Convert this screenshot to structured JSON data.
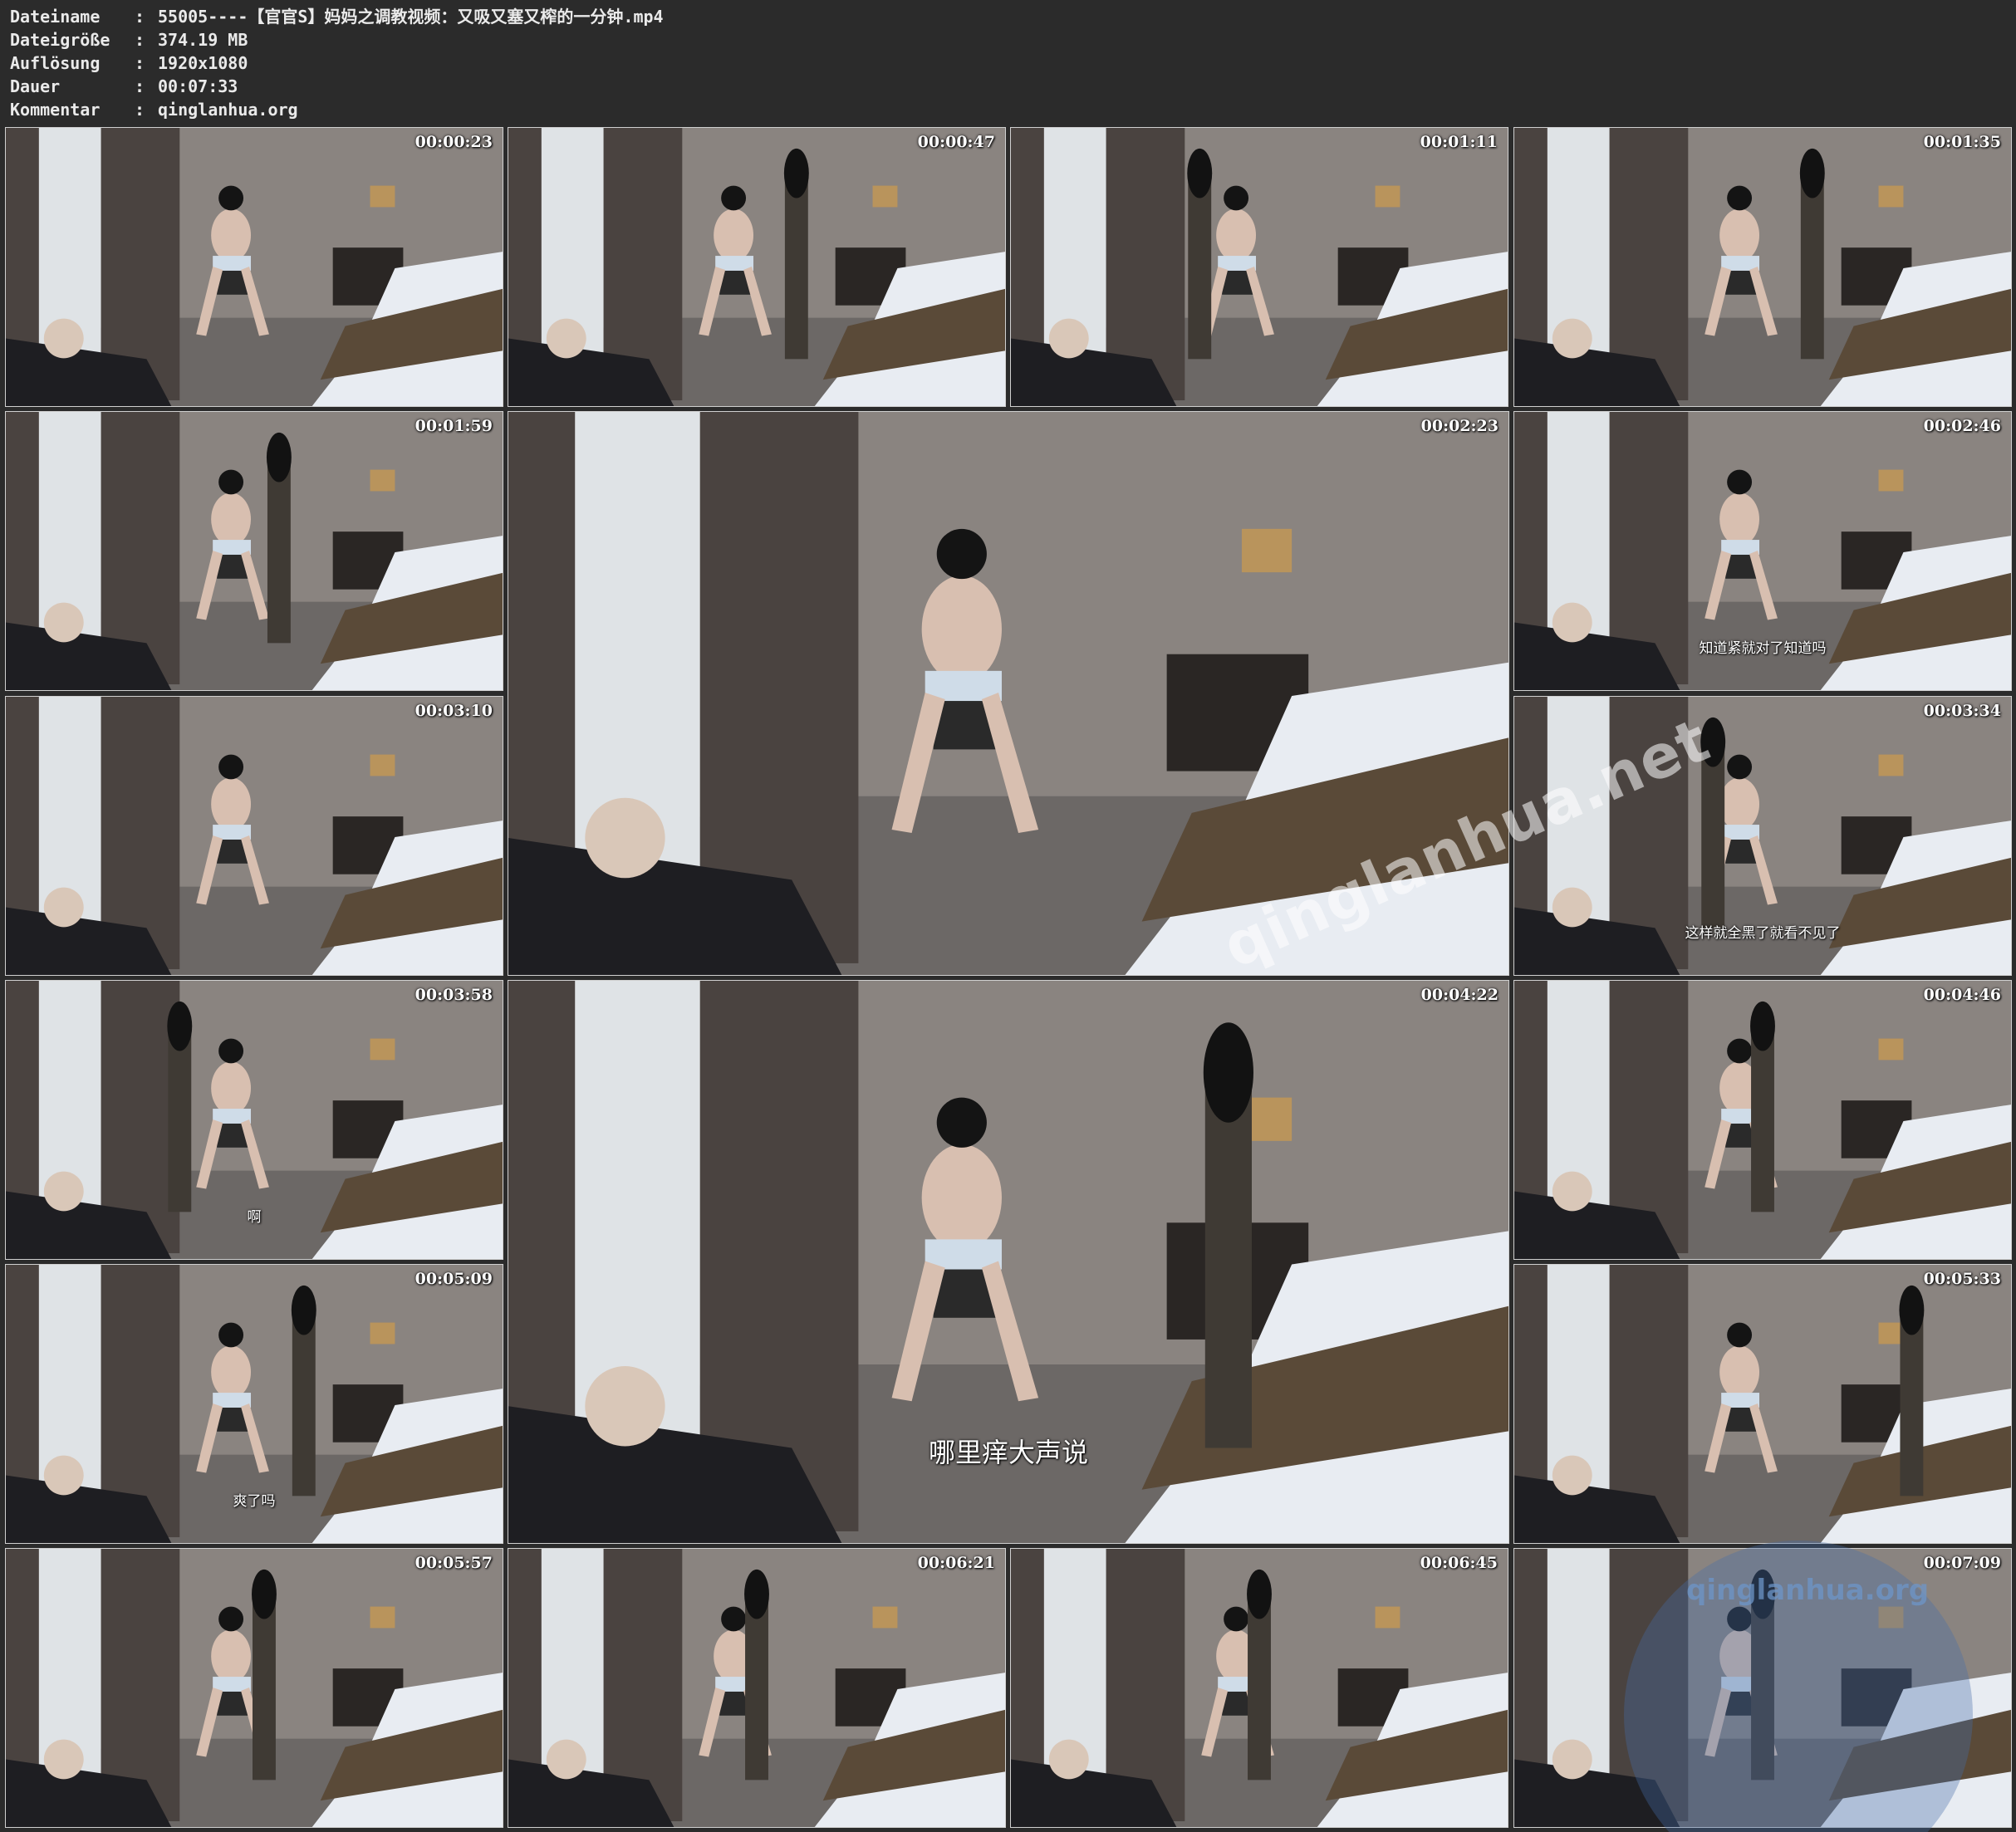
{
  "meta": {
    "filename_label": "Dateiname",
    "filename_value": "55005----【官官S】妈妈之调教视频：又吸又塞又榨的一分钟.mp4",
    "filesize_label": "Dateigröße",
    "filesize_value": "374.19 MB",
    "resolution_label": "Auflösung",
    "resolution_value": "1920x1080",
    "duration_label": "Dauer",
    "duration_value": "00:07:33",
    "comment_label": "Kommentar",
    "comment_value": "qinglanhua.org",
    "separator": ":"
  },
  "thumbnails": [
    {
      "timestamp": "00:00:23",
      "subtitle": ""
    },
    {
      "timestamp": "00:00:47",
      "subtitle": ""
    },
    {
      "timestamp": "00:01:11",
      "subtitle": ""
    },
    {
      "timestamp": "00:01:35",
      "subtitle": ""
    },
    {
      "timestamp": "00:01:59",
      "subtitle": ""
    },
    {
      "timestamp": "00:02:23",
      "subtitle": ""
    },
    {
      "timestamp": "00:02:46",
      "subtitle": "知道紧就对了知道吗"
    },
    {
      "timestamp": "00:03:10",
      "subtitle": ""
    },
    {
      "timestamp": "00:03:34",
      "subtitle": "这样就全黑了就看不见了"
    },
    {
      "timestamp": "00:03:58",
      "subtitle": "啊"
    },
    {
      "timestamp": "00:04:22",
      "subtitle": "哪里痒大声说"
    },
    {
      "timestamp": "00:04:46",
      "subtitle": ""
    },
    {
      "timestamp": "00:05:09",
      "subtitle": "爽了吗"
    },
    {
      "timestamp": "00:05:33",
      "subtitle": ""
    },
    {
      "timestamp": "00:05:57",
      "subtitle": ""
    },
    {
      "timestamp": "00:06:21",
      "subtitle": ""
    },
    {
      "timestamp": "00:06:45",
      "subtitle": ""
    },
    {
      "timestamp": "00:07:09",
      "subtitle": ""
    }
  ],
  "watermarks": {
    "diagonal": "qinglanhua.net",
    "corner": "qinglanhua.org"
  },
  "colors": {
    "background": "#2b2b2b",
    "text": "#eaeaea",
    "wall": "#8a8480",
    "curtain": "#4a4340",
    "bed": "#e8ecf2",
    "runner": "#5a4a38"
  }
}
